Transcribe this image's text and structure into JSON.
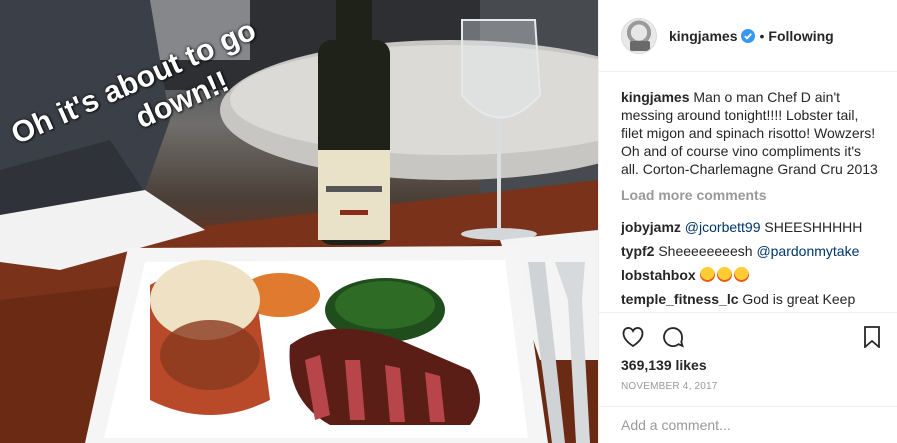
{
  "photo": {
    "alt_scene": "dinner-plate-photo",
    "overlay_line1": "Oh it's about to go",
    "overlay_line2": "down!!"
  },
  "header": {
    "username": "kingjames",
    "separator": "•",
    "follow_status": "Following"
  },
  "caption": {
    "username": "kingjames",
    "text": "Man o man Chef D ain't messing around tonight!!!! Lobster tail, filet migon and spinach risotto! Wowzers! Oh and of course vino compliments it's all. Corton-Charlemagne Grand Cru 2013"
  },
  "load_more": "Load more comments",
  "comments": [
    {
      "user": "jobyjamz",
      "mention": "@jcorbett99",
      "text": "SHEESHHHHH"
    },
    {
      "user": "typf2",
      "text": "Sheeeeeeeesh",
      "mention": "@pardonmytake"
    },
    {
      "user": "lobstahbox",
      "emoji_count": 3
    },
    {
      "user": "temple_fitness_lc",
      "text": "God is great Keep"
    }
  ],
  "likes": "369,139 likes",
  "date": "NOVEMBER 4, 2017",
  "add_comment_placeholder": "Add a comment...",
  "colors": {
    "verified": "#3897f0",
    "mention": "#003569",
    "muted": "#999999"
  },
  "icons": [
    "verified-badge-icon",
    "heart-icon",
    "comment-icon",
    "bookmark-icon"
  ]
}
